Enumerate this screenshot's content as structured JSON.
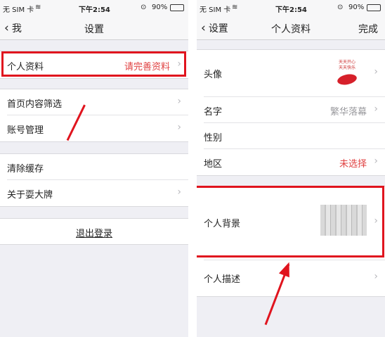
{
  "left": {
    "status": {
      "carrier": "无 SIM 卡",
      "time": "下午2:54",
      "battery": "90%"
    },
    "nav": {
      "back_label": "我",
      "title": "设置"
    },
    "rows": {
      "profile": {
        "label": "个人资料",
        "value": "请完善资料"
      },
      "home_filter": {
        "label": "首页内容筛选"
      },
      "account": {
        "label": "账号管理"
      },
      "clear_cache": {
        "label": "清除缓存"
      },
      "about": {
        "label": "关于耍大牌"
      },
      "logout": {
        "label": "退出登录"
      }
    }
  },
  "right": {
    "status": {
      "carrier": "无 SIM 卡",
      "time": "下午2:54",
      "battery": "90%"
    },
    "nav": {
      "back_label": "设置",
      "title": "个人资料",
      "done_label": "完成"
    },
    "rows": {
      "avatar": {
        "label": "头像",
        "avatar_caption_1": "天天开心",
        "avatar_caption_2": "天天快乐"
      },
      "name": {
        "label": "名字",
        "value": "繁华落幕"
      },
      "gender": {
        "label": "性别"
      },
      "region": {
        "label": "地区",
        "value": "未选择"
      },
      "background": {
        "label": "个人背景"
      },
      "description": {
        "label": "个人描述"
      }
    }
  },
  "colors": {
    "highlight": "#e0141e",
    "accent_red": "#e04141",
    "page_bg": "#efeff4"
  }
}
